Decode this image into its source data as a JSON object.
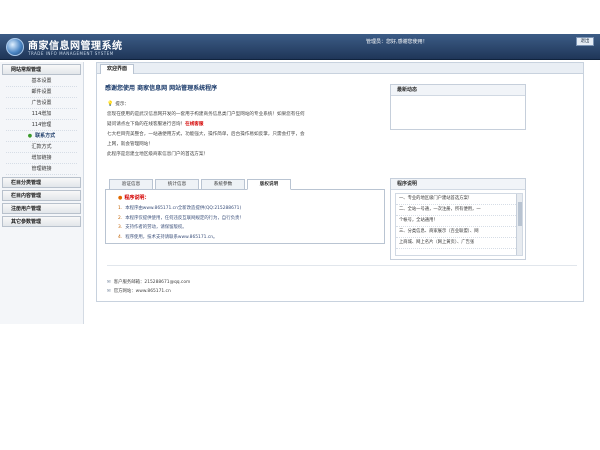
{
  "header": {
    "title": "商家信息网管理系统",
    "subtitle": "TRADE INFO MANAGEMENT SYSTEM",
    "user_text": "管理员：您好,感谢您使用！",
    "logout_label": "退出"
  },
  "sidebar": {
    "section_title": "网站常规管理",
    "items": [
      {
        "label": "基本设置"
      },
      {
        "label": "邮件设置"
      },
      {
        "label": "广告设置"
      },
      {
        "label": "114增加"
      },
      {
        "label": "114管理"
      },
      {
        "label": "联系方式"
      },
      {
        "label": "汇款方式"
      },
      {
        "label": "增加链接"
      },
      {
        "label": "管理链接"
      }
    ],
    "groups": [
      {
        "label": "栏目分类管理"
      },
      {
        "label": "栏目内容管理"
      },
      {
        "label": "注册用户管理"
      },
      {
        "label": "其它参数管理"
      }
    ]
  },
  "main": {
    "tab_label": "欢迎界面",
    "welcome_title": "感谢您使用  商家信息网  网站管理系统程序",
    "tip_head": "提示：",
    "tip_lines": [
      "您现在使用的是武汉信息网开发的一套用于构建商务信息类门户型网站的专业系统！如果您有任何",
      "疑问请点左下角的在线客服进行咨询！",
      "七大栏目完美整合，一站通便用方式，功能强大，操作简单，后台操作易如反掌，只需会打字，会",
      "上网，就会管理网站！",
      "此程序是您建立地区级商家信息门户的首选方案！"
    ],
    "tip_red": "在线客服",
    "sub_tabs": [
      "验证信息",
      "统计信息",
      "系统参数",
      "版权说明"
    ],
    "notice_title": "程序说明：",
    "notice_items": [
      "本程序由www.865171.cn全新改造提供(QQ:215288671)",
      "本程序仅提供使用，任何违反互联网规定的行为，自行负责！",
      "支持作者的劳动，请保留版权。",
      "程序使用，技术支持请联系www.865171.cn。"
    ],
    "box1_title": "最新动态",
    "box2_title": "程序说明",
    "box2_lines": [
      "一、专业的地区级门户建站首选方案！",
      "二、全站一号通，一次注册，所有便用，一",
      "个帐号，全站通用！",
      "三、分类信息、商家展示（百业联盟）、网",
      "上商城、网上名片（网上黄页）、广告张"
    ],
    "contact_email": "客户服务邮箱：215288671@qq.com",
    "contact_site": "官方网站：www.865171.cn"
  }
}
